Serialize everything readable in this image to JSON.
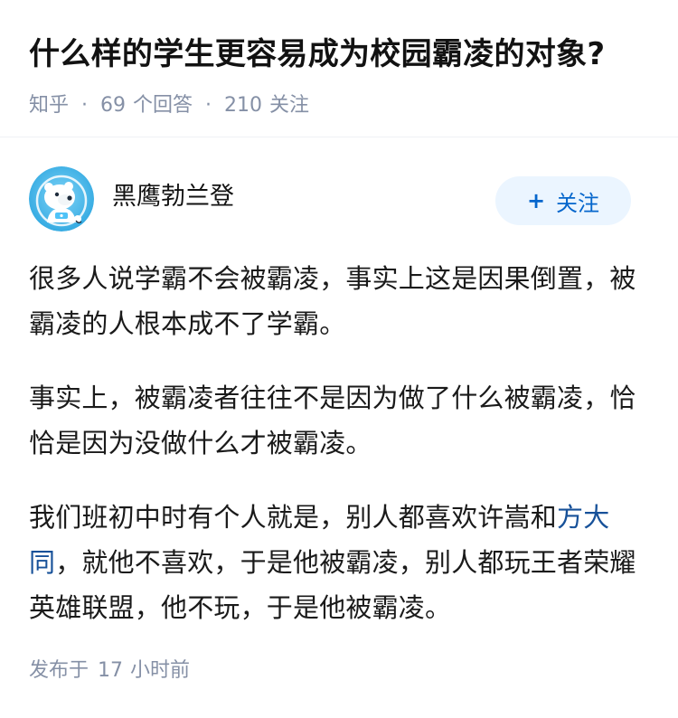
{
  "question": {
    "title": "什么样的学生更容易成为校园霸凌的对象?",
    "source": "知乎",
    "answer_count": "69",
    "answer_count_label": "个回答",
    "follow_count": "210",
    "follow_count_label": "关注"
  },
  "author": {
    "name": "黑鹰勃兰登",
    "follow_button_label": "关注",
    "avatar_icon": "polar-bear-astronaut-icon"
  },
  "answer": {
    "paragraph_1": "很多人说学霸不会被霸凌，事实上这是因果倒置，被霸凌的人根本成不了学霸。",
    "paragraph_2": "事实上，被霸凌者往往不是因为做了什么被霸凌，恰恰是因为没做什么才被霸凌。",
    "paragraph_3_before_link": "我们班初中时有个人就是，别人都喜欢许嵩和",
    "paragraph_3_link": "方大同",
    "paragraph_3_after_link": "，就他不喜欢，于是他被霸凌，别人都玩王者荣耀英雄联盟，他不玩，于是他被霸凌。",
    "published_prefix": "发布于",
    "published_value": "17",
    "published_unit": "小时前"
  },
  "colors": {
    "muted": "#8590a6",
    "link": "#175199",
    "follow_bg": "#ebf5ff",
    "follow_text": "#0566cc"
  }
}
